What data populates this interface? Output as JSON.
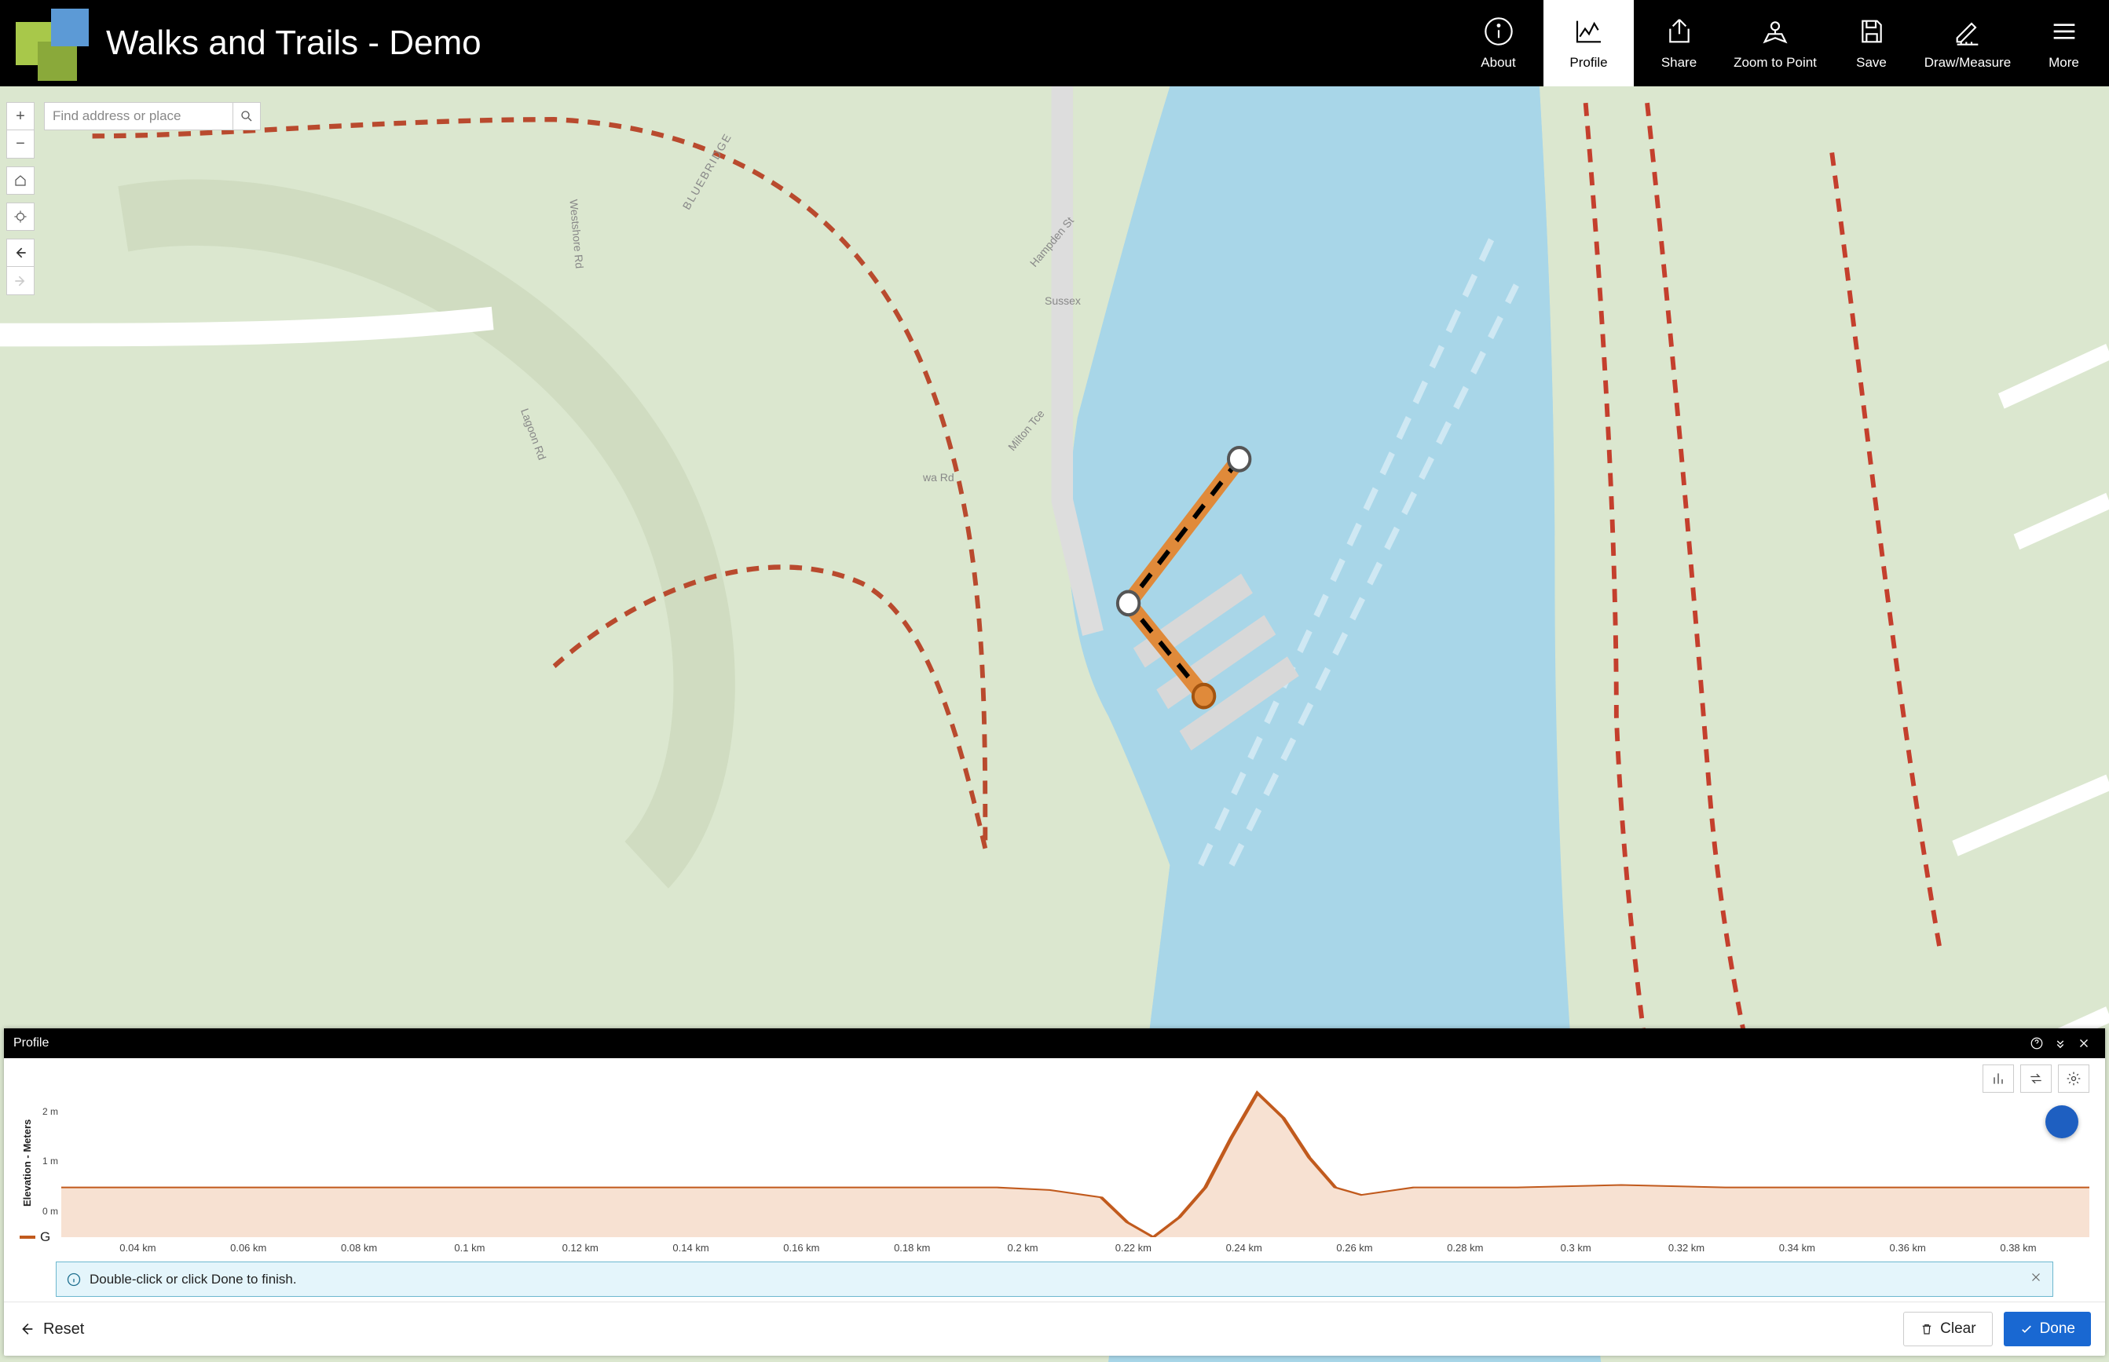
{
  "header": {
    "title": "Walks and Trails - Demo",
    "nav": {
      "about": "About",
      "profile": "Profile",
      "share": "Share",
      "zoom": "Zoom to Point",
      "save": "Save",
      "draw": "Draw/Measure",
      "more": "More"
    }
  },
  "search": {
    "placeholder": "Find address or place"
  },
  "map_labels": {
    "westshore": "Westshore Rd",
    "bluebridge": "BLUEBRIDGE",
    "lagoon": "Lagoon Rd",
    "hampden": "Hampden St",
    "sussex": "Sussex",
    "milton": "Milton Tce",
    "wa": "wa Rd"
  },
  "panel": {
    "title": "Profile",
    "tip": "Double-click or click Done to finish.",
    "reset": "Reset",
    "clear": "Clear",
    "done": "Done",
    "legend_letter": "G"
  },
  "chart_data": {
    "type": "line",
    "title": "",
    "xlabel": "",
    "ylabel": "Elevation - Meters",
    "ylim": [
      -1,
      2
    ],
    "y_ticks": [
      "2 m",
      "1 m",
      "0 m"
    ],
    "x_ticks": [
      "0.04 km",
      "0.06 km",
      "0.08 km",
      "0.1 km",
      "0.12 km",
      "0.14 km",
      "0.16 km",
      "0.18 km",
      "0.2 km",
      "0.22 km",
      "0.24 km",
      "0.26 km",
      "0.28 km",
      "0.3 km",
      "0.32 km",
      "0.34 km",
      "0.36 km",
      "0.38 km"
    ],
    "x": [
      0.0,
      0.02,
      0.04,
      0.06,
      0.08,
      0.1,
      0.12,
      0.14,
      0.16,
      0.18,
      0.19,
      0.2,
      0.205,
      0.21,
      0.215,
      0.22,
      0.225,
      0.23,
      0.235,
      0.24,
      0.245,
      0.25,
      0.26,
      0.28,
      0.3,
      0.32,
      0.34,
      0.36,
      0.38,
      0.39
    ],
    "values": [
      0.0,
      0.0,
      0.0,
      0.0,
      0.0,
      0.0,
      0.0,
      0.0,
      0.0,
      0.0,
      -0.05,
      -0.2,
      -0.7,
      -1.0,
      -0.6,
      0.0,
      1.0,
      1.9,
      1.4,
      0.6,
      0.0,
      -0.15,
      0.0,
      0.0,
      0.05,
      0.0,
      0.0,
      0.0,
      0.0,
      0.0
    ]
  }
}
